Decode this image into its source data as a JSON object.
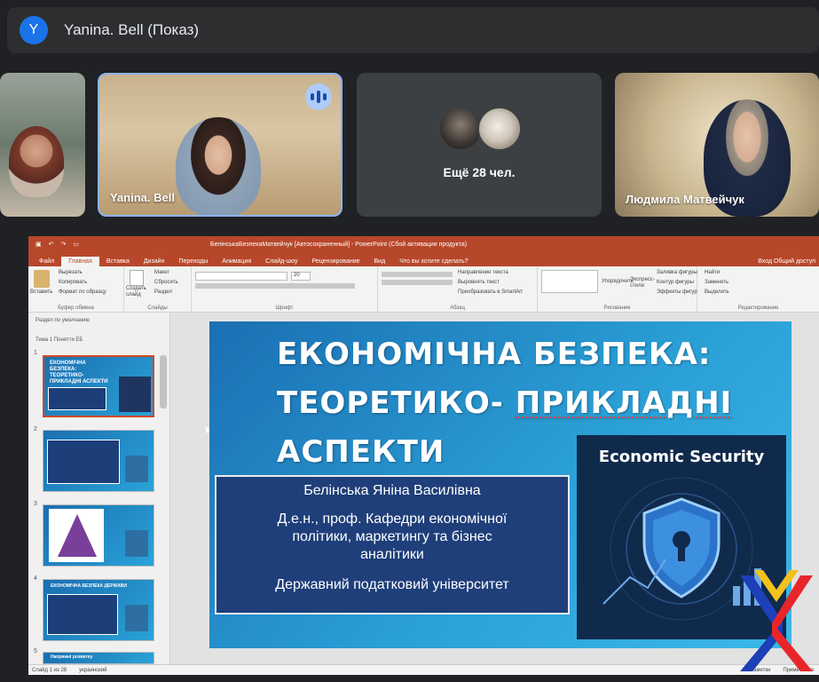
{
  "presenter": {
    "avatar_letter": "Y",
    "label": "Yanina. Bell (Показ)"
  },
  "tiles": {
    "tile2_name": "Yanina. Bell",
    "more_label": "Ещё 28 чел.",
    "tile4_name": "Людмила Матвейчук"
  },
  "ppt": {
    "doc_title": "БелінськаБезпекаМатвейчук [Автосохраненный] - PowerPoint (Сбой активации продукта)",
    "menu": [
      "Файл",
      "Главная",
      "Вставка",
      "Дизайн",
      "Переходы",
      "Анимация",
      "Слайд-шоу",
      "Рецензирование",
      "Вид",
      "Что вы хотите сделать?"
    ],
    "menu_right": "Вход   Общий доступ",
    "ribbon": {
      "paste": "Вставить",
      "cut": "Вырезать",
      "copy": "Копировать",
      "format_painter": "Формат по образцу",
      "clipboard": "Буфер обмена",
      "new_slide": "Создать слайд",
      "layout": "Макет",
      "reset": "Сбросить",
      "section": "Раздел",
      "slides": "Слайды",
      "font_group": "Шрифт",
      "font_size": "20",
      "text_dir": "Направление текста",
      "align_text": "Выровнять текст",
      "smartart": "Преобразовать в SmartArt",
      "paragraph": "Абзац",
      "arrange": "Упорядочить",
      "quick_styles": "Экспресс-стили",
      "fill": "Заливка фигуры",
      "outline": "Контур фигуры",
      "effects": "Эффекты фигур",
      "drawing": "Рисование",
      "find": "Найти",
      "replace": "Заменить",
      "select": "Выделить",
      "editing": "Редактирование"
    },
    "panel": {
      "section1": "Раздел по умолчанию",
      "section2": "Тема 1 Поняття ЕБ",
      "thumb_numbers": [
        "1",
        "2",
        "3",
        "4",
        "5"
      ],
      "thumb1_title": "ЕКОНОМІЧНА БЕЗПЕКА: ТЕОРЕТИКО-ПРИКЛАДНІ АСПЕКТИ",
      "thumb4_title": "ЕКОНОМІЧНА БЕЗПЕКА ДЕРЖАВИ",
      "thumb5_title": "Напрямні розвитку"
    },
    "slide": {
      "title_line1": "ЕКОНОМІЧНА БЕЗПЕКА:",
      "title_line2a": "ТЕОРЕТИКО-",
      "title_line2b": "ПРИКЛАДНІ",
      "title_line3": "АСПЕКТИ",
      "author": "Белінська Яніна Василівна",
      "position_l1": "Д.е.н., проф. Кафедри економічної",
      "position_l2": "політики, маркетингу та бізнес",
      "position_l3": "аналітики",
      "university": "Державний податковий університет",
      "card_title": "Economic Security"
    },
    "status": {
      "slide_info": "Слайд 1 из 28",
      "language": "украинский",
      "notes": "Заметки",
      "comments": "Примечания"
    }
  },
  "colors": {
    "meet_bg": "#202124",
    "ppt_accent": "#b7472a",
    "avatar": "#1a73e8",
    "speaking": "#aecbfa"
  }
}
